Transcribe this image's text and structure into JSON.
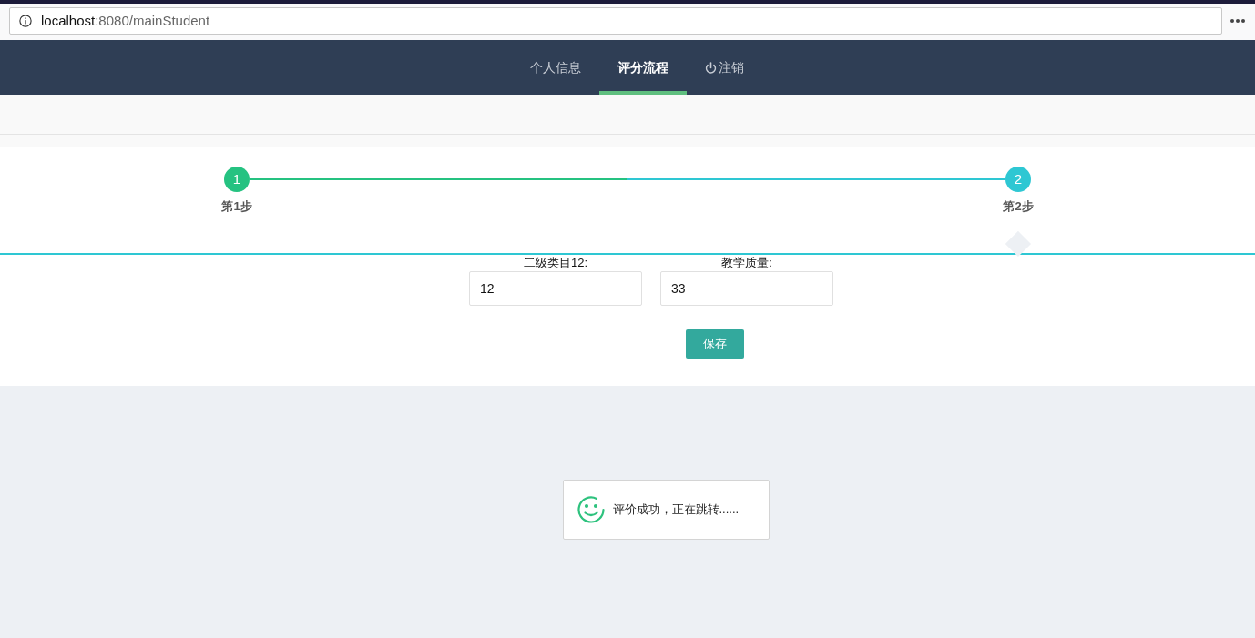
{
  "browser": {
    "url_host": "localhost",
    "url_rest": ":8080/mainStudent"
  },
  "nav": {
    "items": [
      {
        "label": "个人信息",
        "selected": false,
        "kind": "link"
      },
      {
        "label": "评分流程",
        "selected": true,
        "kind": "link"
      },
      {
        "label": "注销",
        "selected": false,
        "kind": "logout"
      }
    ]
  },
  "steps": [
    {
      "number": "1",
      "label": "第1步",
      "completed": true
    },
    {
      "number": "2",
      "label": "第2步",
      "completed": false
    }
  ],
  "form": {
    "fields": [
      {
        "label": "二级类目12:",
        "value": "12"
      },
      {
        "label": "教学质量:",
        "value": "33"
      }
    ],
    "save_button": "保存"
  },
  "toast": {
    "message": "评价成功，正在跳转......"
  }
}
